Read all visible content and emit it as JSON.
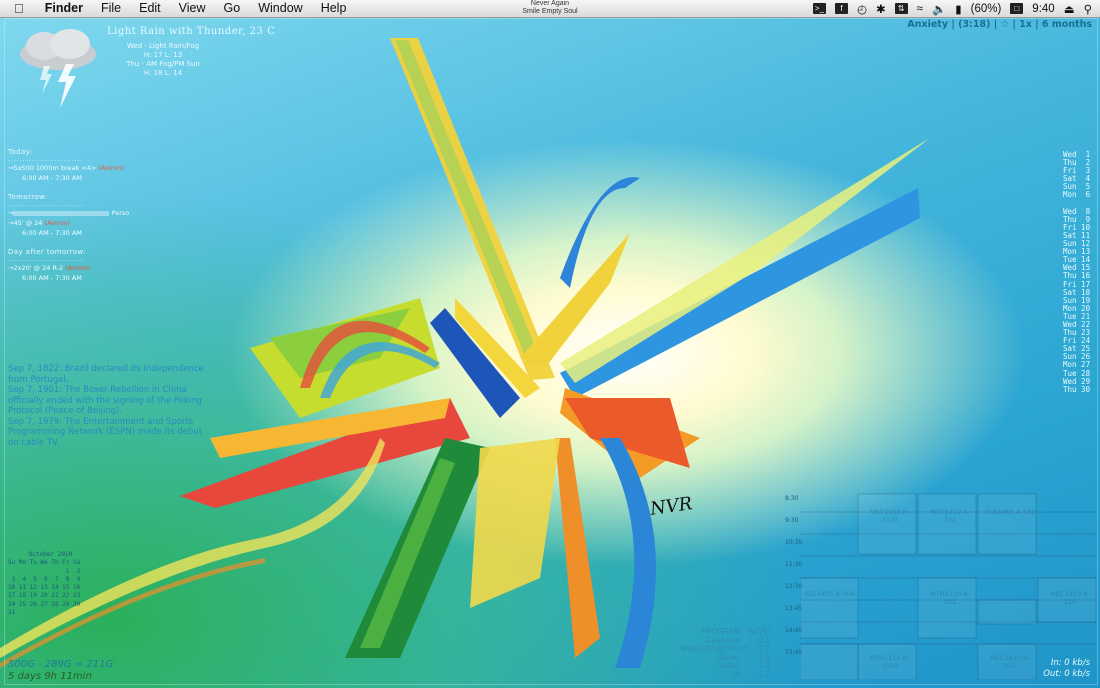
{
  "menubar": {
    "apple_icon": "apple-logo-icon",
    "app": "Finder",
    "menus": [
      "File",
      "Edit",
      "View",
      "Go",
      "Window",
      "Help"
    ],
    "now_playing": [
      "Never Again",
      "Smile Empty Soul"
    ],
    "battery": "(60%)",
    "clock": "9:40"
  },
  "weather": {
    "title": "Light Rain with Thunder, 23 C",
    "forecast": [
      "Wed - Light Rain/Fog",
      "H: 17  L: 13",
      "Thu - AM Fog/PM Sun",
      "H: 18  L: 14"
    ],
    "icon": "storm-cloud-icon"
  },
  "agenda": {
    "today_label": "Today:",
    "today_items": [
      {
        "text": "5x500 1000m break <4>",
        "tag": "(Aviron)",
        "time": "6:00 AM - 7:30 AM"
      }
    ],
    "tomorrow_label": "Tomorrow:",
    "tomorrow_items": [
      {
        "text": "Perso",
        "tag": "",
        "time": ""
      },
      {
        "text": "45' @ 24",
        "tag": "(Aviron)",
        "time": "6:00 AM - 7:30 AM"
      }
    ],
    "after_label": "Day after tomorrow:",
    "after_items": [
      {
        "text": "2x20' @ 24 R-2",
        "tag": "(Aviron)",
        "time": "6:00 AM - 7:30 AM"
      }
    ]
  },
  "history": [
    "Sep 7, 1822: Brazil declared its independence from Portugal.",
    "Sep 7, 1901: The Boxer Rebellion in China officially ended with the signing of the Peking Protocol (Peace of Beijing).",
    "Sep 7, 1979: The Entertainment and Sports Programming Network (ESPN) made its debut on cable TV."
  ],
  "month_calendar": {
    "title": "October 2010",
    "days_header": "Su Mo Tu We Th Fr Sa",
    "weeks": [
      "                1  2",
      " 3  4  5  6  7  8  9",
      "10 11 12 13 14 15 16",
      "17 18 19 20 21 22 23",
      "24 25 26 27 28 29 30",
      "31"
    ]
  },
  "disk": {
    "usage": "500G - 289G = 211G",
    "uptime": "5 days 9h 11min"
  },
  "track_info": "Anxiety | (3:18) | ☆ | 1x | 6 months",
  "day_list": [
    "Wed  1",
    "Thu  2",
    "Fri  3",
    "Sat  4",
    "Sun  5",
    "Mon  6",
    "",
    "Wed  8",
    "Thu  9",
    "Fri 10",
    "Sat 11",
    "Sun 12",
    "Mon 13",
    "Tue 14",
    "Wed 15",
    "Thu 16",
    "Fri 17",
    "Sat 18",
    "Sun 19",
    "Mon 20",
    "Tue 21",
    "Wed 22",
    "Thu 23",
    "Fri 24",
    "Sat 25",
    "Sun 26",
    "Mon 27",
    "Tue 28",
    "Wed 29",
    "Thu 30"
  ],
  "processes": {
    "header": [
      "PROGRAM",
      "%CPU"
    ],
    "rows": [
      [
        "GeekTool",
        "9.1"
      ],
      [
        "WebKitPluginHost",
        "7.2"
      ],
      [
        "iTunes",
        "5.0"
      ],
      [
        "Safari",
        "3.9"
      ],
      [
        "sh",
        "1.7"
      ]
    ]
  },
  "network": {
    "in": "In: 0 kb/s",
    "out": "Out: 0 kb/s"
  },
  "schedule": {
    "times": [
      "8:30",
      "9:30",
      "10:30",
      "11:30",
      "12:30",
      "13:45",
      "14:45",
      "15:45"
    ],
    "blocks": [
      "MEC1410 H-1120",
      "MEC1410 A-332",
      "ELE4455 A-332",
      "ELE4455 B-506",
      "MTH1110 A-332",
      "MEC1410 B-318",
      "MTH1110 M-1120",
      "MEC1410 A-522"
    ]
  },
  "signature": "NVR"
}
